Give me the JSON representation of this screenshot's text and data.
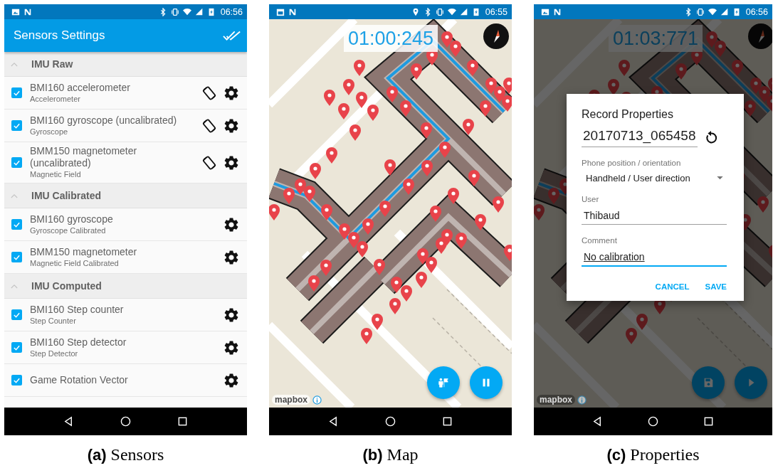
{
  "panels": [
    {
      "kind": "sensors",
      "status_time": "06:56",
      "title": "Sensors Settings",
      "groups": [
        {
          "title": "IMU Raw",
          "expanded": true,
          "sensors": [
            {
              "name": "BMI160 accelerometer",
              "type": "Accelerometer",
              "checked": true,
              "calibratable": true
            },
            {
              "name": "BMI160 gyroscope (uncalibrated)",
              "type": "Gyroscope",
              "checked": true,
              "calibratable": true
            },
            {
              "name": "BMM150 magnetometer (uncalibrated)",
              "type": "Magnetic Field",
              "checked": true,
              "calibratable": true
            }
          ]
        },
        {
          "title": "IMU Calibrated",
          "expanded": true,
          "sensors": [
            {
              "name": "BMI160 gyroscope",
              "type": "Gyroscope Calibrated",
              "checked": true,
              "calibratable": false
            },
            {
              "name": "BMM150 magnetometer",
              "type": "Magnetic Field Calibrated",
              "checked": true,
              "calibratable": false
            }
          ]
        },
        {
          "title": "IMU Computed",
          "expanded": true,
          "sensors": [
            {
              "name": "BMI160 Step counter",
              "type": "Step Counter",
              "checked": true,
              "calibratable": false
            },
            {
              "name": "BMI160 Step detector",
              "type": "Step Detector",
              "checked": true,
              "calibratable": false
            },
            {
              "name": "Game Rotation Vector",
              "checked": true,
              "calibratable": false
            }
          ]
        }
      ],
      "caption": {
        "tag": "(a)",
        "text": "Sensors"
      }
    },
    {
      "kind": "map",
      "status_time": "06:55",
      "timer": "01:00:245",
      "attribution": "mapbox",
      "recording": true,
      "caption": {
        "tag": "(b)",
        "text": "Map"
      }
    },
    {
      "kind": "properties",
      "status_time": "06:56",
      "timer": "01:03:771",
      "attribution": "mapbox",
      "recording": false,
      "dialog": {
        "title": "Record Properties",
        "record_name": "20170713_065458",
        "fields": [
          {
            "kind": "dropdown",
            "label": "Phone position / orientation",
            "value": "Handheld / User direction"
          },
          {
            "kind": "text",
            "label": "User",
            "value": "Thibaud",
            "focused": false
          },
          {
            "kind": "text",
            "label": "Comment",
            "value": "No calibration",
            "focused": true
          }
        ],
        "actions": [
          "CANCEL",
          "SAVE"
        ]
      },
      "caption": {
        "tag": "(c)",
        "text": "Properties"
      }
    }
  ]
}
